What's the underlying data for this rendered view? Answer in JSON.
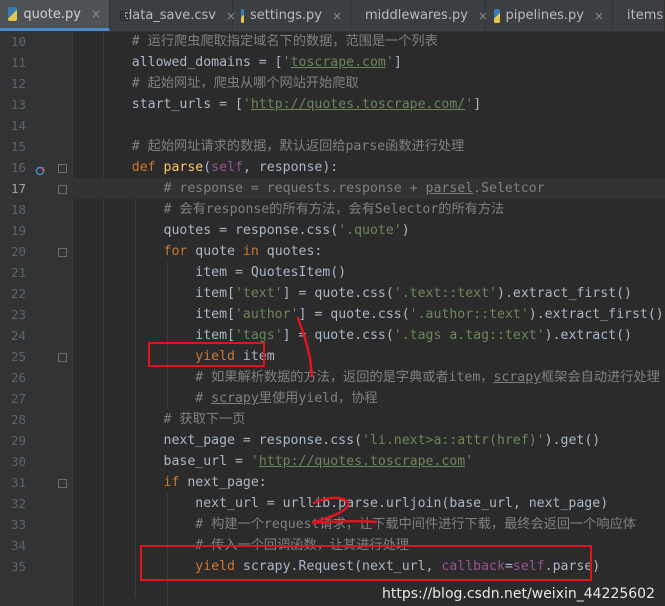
{
  "tabs": [
    {
      "label": "quote.py",
      "icon": "python-file-icon",
      "active": true
    },
    {
      "label": "data_save.csv",
      "icon": "csv-file-icon",
      "active": false
    },
    {
      "label": "settings.py",
      "icon": "python-file-icon",
      "active": false
    },
    {
      "label": "middlewares.py",
      "icon": "python-file-icon",
      "active": false
    },
    {
      "label": "pipelines.py",
      "icon": "python-file-icon",
      "active": false
    },
    {
      "label": "items",
      "icon": "python-file-icon",
      "active": false
    }
  ],
  "lines": [
    {
      "num": "10",
      "t": [
        [
          "c",
          "    # 运行爬虫爬取指定域名下的数据，范围是一个列表"
        ]
      ]
    },
    {
      "num": "11",
      "t": [
        [
          "n",
          "    allowed_domains = ["
        ],
        [
          "s",
          "'"
        ],
        [
          "u",
          "toscrape.com"
        ],
        [
          "s",
          "'"
        ],
        [
          "n",
          "]"
        ]
      ]
    },
    {
      "num": "12",
      "t": [
        [
          "c",
          "    # 起始网址，爬虫从哪个网站开始爬取"
        ]
      ]
    },
    {
      "num": "13",
      "t": [
        [
          "n",
          "    start_urls = ["
        ],
        [
          "s",
          "'"
        ],
        [
          "u",
          "http://quotes.toscrape.com/"
        ],
        [
          "s",
          "'"
        ],
        [
          "n",
          "]"
        ]
      ]
    },
    {
      "num": "14",
      "t": []
    },
    {
      "num": "15",
      "t": [
        [
          "c",
          "    # 起始网址请求的数据，默认返回给parse函数进行处理"
        ]
      ]
    },
    {
      "num": "16",
      "t": [
        [
          "k",
          "    def "
        ],
        [
          "f",
          "parse"
        ],
        [
          "n",
          "("
        ],
        [
          "p",
          "self"
        ],
        [
          "n",
          ", response):"
        ]
      ]
    },
    {
      "num": "17",
      "t": [
        [
          "c",
          "        # response = requests.response + "
        ],
        [
          "cu",
          "parsel"
        ],
        [
          "c",
          ".Seletcor"
        ]
      ]
    },
    {
      "num": "18",
      "t": [
        [
          "c",
          "        # 会有response的所有方法，会有Selector的所有方法"
        ]
      ]
    },
    {
      "num": "19",
      "t": [
        [
          "n",
          "        quotes = response.css("
        ],
        [
          "s",
          "'.quote'"
        ],
        [
          "n",
          ")"
        ]
      ]
    },
    {
      "num": "20",
      "t": [
        [
          "k",
          "        for "
        ],
        [
          "n",
          "quote "
        ],
        [
          "k",
          "in "
        ],
        [
          "n",
          "quotes:"
        ]
      ]
    },
    {
      "num": "21",
      "t": [
        [
          "n",
          "            item = QuotesItem()"
        ]
      ]
    },
    {
      "num": "22",
      "t": [
        [
          "n",
          "            item["
        ],
        [
          "s",
          "'text'"
        ],
        [
          "n",
          "] = quote.css("
        ],
        [
          "s",
          "'.text::text'"
        ],
        [
          "n",
          ").extract_first()"
        ]
      ]
    },
    {
      "num": "23",
      "t": [
        [
          "n",
          "            item["
        ],
        [
          "s",
          "'author'"
        ],
        [
          "n",
          "] = quote.css("
        ],
        [
          "s",
          "'.author::text'"
        ],
        [
          "n",
          ").extract_first()"
        ]
      ]
    },
    {
      "num": "24",
      "t": [
        [
          "n",
          "            item["
        ],
        [
          "s",
          "'tags'"
        ],
        [
          "n",
          "] = quote.css("
        ],
        [
          "s",
          "'.tags a.tag::text'"
        ],
        [
          "n",
          ").extract()"
        ]
      ]
    },
    {
      "num": "25",
      "t": [
        [
          "k",
          "            yield "
        ],
        [
          "n",
          "item"
        ]
      ]
    },
    {
      "num": "26",
      "t": [
        [
          "c",
          "            # 如果解析数据的方法，返回的是字典或者item，"
        ],
        [
          "cu",
          "scrapy"
        ],
        [
          "c",
          "框架会自动进行处理"
        ]
      ]
    },
    {
      "num": "27",
      "t": [
        [
          "c",
          "            # "
        ],
        [
          "cu",
          "scrapy"
        ],
        [
          "c",
          "里使用yield，协程"
        ]
      ]
    },
    {
      "num": "28",
      "t": [
        [
          "c",
          "        # 获取下一页"
        ]
      ]
    },
    {
      "num": "29",
      "t": [
        [
          "n",
          "        next_page = response.css("
        ],
        [
          "s",
          "'li.next>a::attr(href)'"
        ],
        [
          "n",
          ").get()"
        ]
      ]
    },
    {
      "num": "30",
      "t": [
        [
          "n",
          "        base_url = "
        ],
        [
          "s",
          "'"
        ],
        [
          "u",
          "http://quotes.toscrape.com"
        ],
        [
          "s",
          "'"
        ]
      ]
    },
    {
      "num": "31",
      "t": [
        [
          "k",
          "        if "
        ],
        [
          "n",
          "next_page:"
        ]
      ]
    },
    {
      "num": "32",
      "t": [
        [
          "n",
          "            next_url = urllib.parse.urljoin(base_url, next_page)"
        ]
      ]
    },
    {
      "num": "33",
      "t": [
        [
          "c",
          "            # 构建一个request请求，让下载中间件进行下载，最终会返回一个响应体"
        ]
      ]
    },
    {
      "num": "34",
      "t": [
        [
          "c",
          "            # 传入一个回调函数，让其进行处理"
        ]
      ]
    },
    {
      "num": "35",
      "t": [
        [
          "k",
          "            yield "
        ],
        [
          "n",
          "scrapy.Request(next_url, "
        ],
        [
          "kw",
          "callback"
        ],
        [
          "n",
          "="
        ],
        [
          "p",
          "self"
        ],
        [
          "n",
          ".parse)"
        ]
      ]
    }
  ],
  "watermark": "https://blog.csdn.net/weixin_44225602",
  "colors": {
    "background": "#2b2b2b",
    "keyword": "#cc7832",
    "string": "#6a8759",
    "comment": "#808080",
    "function": "#ffc66d",
    "self": "#94558d",
    "annotation": "#e0141e"
  }
}
